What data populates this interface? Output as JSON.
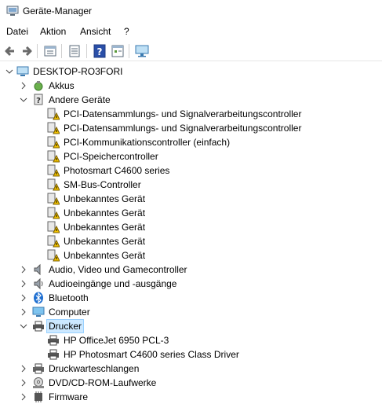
{
  "window": {
    "title": "Geräte-Manager"
  },
  "menu": [
    "Datei",
    "Aktion",
    "Ansicht",
    "?"
  ],
  "toolbar": {
    "buttons": [
      "back-icon",
      "forward-icon",
      "properties-icon",
      "view-icon",
      "help-icon",
      "view2-icon",
      "monitor-icon"
    ]
  },
  "tree": {
    "root": "DESKTOP-RO3FORI",
    "akkus": "Akkus",
    "andere": {
      "label": "Andere Geräte",
      "items": [
        "PCI-Datensammlungs- und Signalverarbeitungscontroller",
        "PCI-Datensammlungs- und Signalverarbeitungscontroller",
        "PCI-Kommunikationscontroller (einfach)",
        "PCI-Speichercontroller",
        "Photosmart C4600 series",
        "SM-Bus-Controller",
        "Unbekanntes Gerät",
        "Unbekanntes Gerät",
        "Unbekanntes Gerät",
        "Unbekanntes Gerät",
        "Unbekanntes Gerät"
      ]
    },
    "audio": "Audio, Video und Gamecontroller",
    "audioio": "Audioeingänge und -ausgänge",
    "bluetooth": "Bluetooth",
    "computer": "Computer",
    "drucker": {
      "label": "Drucker",
      "items": [
        "HP OfficeJet 6950 PCL-3",
        "HP Photosmart C4600 series Class Driver"
      ]
    },
    "druckwarteschlangen": "Druckwarteschlangen",
    "dvd": "DVD/CD-ROM-Laufwerke",
    "firmware": "Firmware"
  },
  "colors": {
    "selection": "#cce8ff",
    "warning": "#f5c400",
    "bluetooth": "#1f6fd1"
  }
}
